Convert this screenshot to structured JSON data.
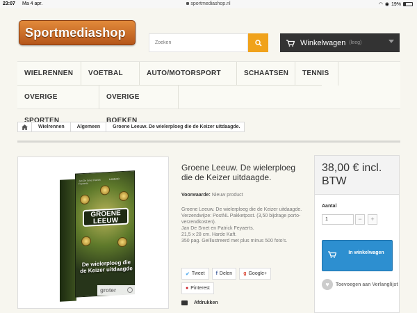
{
  "status": {
    "time": "23:07",
    "date": "Ma 4 apr.",
    "url": "sportmediashop.nl",
    "battery": "19%"
  },
  "logo": {
    "text": "Sportmediashop"
  },
  "search": {
    "placeholder": "Zoeken"
  },
  "cart": {
    "label": "Winkelwagen",
    "state": "(leeg)"
  },
  "nav": {
    "items": [
      "WIELRENNEN",
      "VOETBAL",
      "AUTO/MOTORSPORT",
      "SCHAATSEN",
      "TENNIS",
      "OVERIGE SPORTEN",
      "OVERIGE BOEKEN"
    ]
  },
  "breadcrumb": [
    "Wielrennen",
    "Algemeen",
    "Groene Leeuw. De wielerploeg die de Keizer uitdaagde."
  ],
  "product": {
    "title": "Groene Leeuw. De wielerploeg die de Keizer uitdaagde.",
    "condition_label": "Voorwaarde:",
    "condition_value": "Nieuw product",
    "description": [
      "Groene Leeuw. De wielerploeg die de Keizer uitdaagde.",
      "Verzendwijze: PostNL Pakketpost. (3,50 bijdrage porto-verzendkosten).",
      "Jan De Smet en Patrick Feyaerts.",
      "21,5 x 28 cm. Harde Kaft.",
      "350 pag. Geïllustreerd met plus minus 500 foto's."
    ],
    "enlarge": "groter",
    "cover": {
      "authors": "Jan De Smet\nPatrick Feyaerts",
      "publisher": "LANNOO",
      "title_top": "GROENE LEEUW",
      "title_bottom": "De wielerploeg die de Keizer uitdaagde"
    }
  },
  "social": {
    "tweet": "Tweet",
    "share": "Delen",
    "google": "Google+",
    "pinterest": "Pinterest"
  },
  "print": "Afdrukken",
  "price": {
    "amount": "38,00 € incl. BTW",
    "qty_label": "Aantal",
    "qty_value": "1",
    "minus": "−",
    "plus": "+",
    "add_to_cart": "In winkelwagen",
    "wishlist": "Toevoegen aan Verlanglijst"
  },
  "colors": {
    "accent_orange": "#f0a21b",
    "cart_bg": "#333333",
    "button_blue": "#2d8fd0"
  }
}
